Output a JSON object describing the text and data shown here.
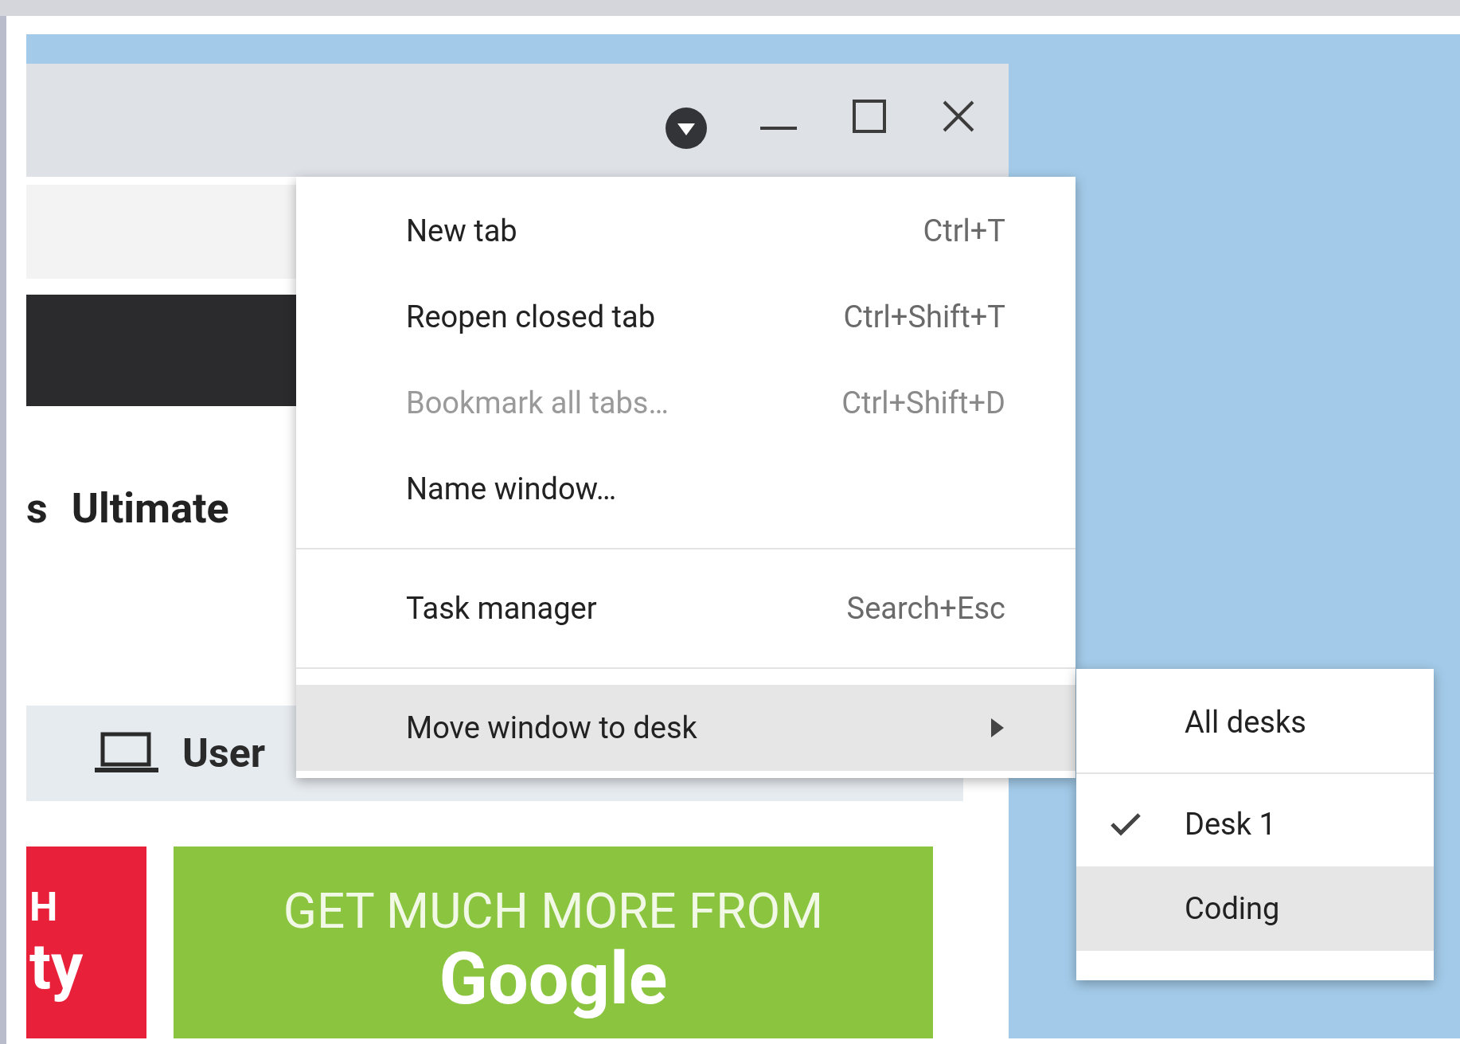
{
  "page": {
    "heading_fragment": "s",
    "heading": "Ultimate",
    "device_label": "User",
    "red_banner_text": [
      "H",
      "ty"
    ],
    "green_banner_tagline": "GET MUCH MORE FROM",
    "green_banner_brand": "Google"
  },
  "menu": {
    "items": [
      {
        "kind": "item",
        "label": "New tab",
        "shortcut": "Ctrl+T",
        "disabled": false,
        "selected": false
      },
      {
        "kind": "item",
        "label": "Reopen closed tab",
        "shortcut": "Ctrl+Shift+T",
        "disabled": false,
        "selected": false
      },
      {
        "kind": "item",
        "label": "Bookmark all tabs…",
        "shortcut": "Ctrl+Shift+D",
        "disabled": true,
        "selected": false
      },
      {
        "kind": "item",
        "label": "Name window…",
        "disabled": false,
        "selected": false
      },
      {
        "kind": "separator"
      },
      {
        "kind": "item",
        "label": "Task manager",
        "shortcut": "Search+Esc",
        "disabled": false,
        "selected": false
      },
      {
        "kind": "separator"
      },
      {
        "kind": "submenu",
        "label": "Move window to desk",
        "disabled": false,
        "selected": true
      }
    ]
  },
  "submenu": {
    "items": [
      {
        "kind": "item",
        "label": "All desks",
        "checked": false,
        "selected": false
      },
      {
        "kind": "separator"
      },
      {
        "kind": "item",
        "label": "Desk 1",
        "checked": true,
        "selected": false
      },
      {
        "kind": "item",
        "label": "Coding",
        "checked": false,
        "selected": true
      }
    ]
  }
}
